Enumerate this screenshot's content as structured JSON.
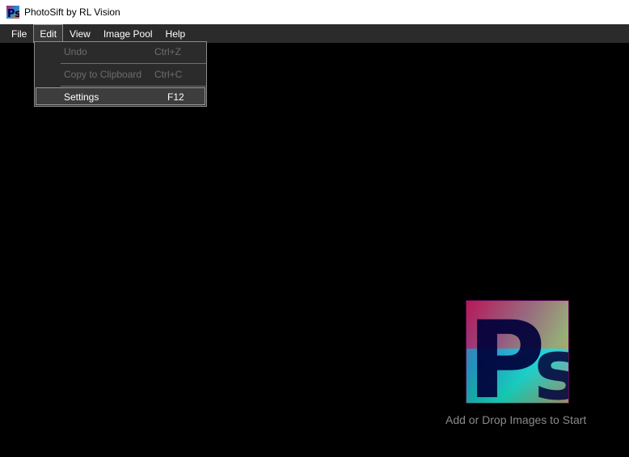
{
  "window": {
    "title": "PhotoSift by RL Vision"
  },
  "menubar": {
    "items": [
      {
        "label": "File"
      },
      {
        "label": "Edit"
      },
      {
        "label": "View"
      },
      {
        "label": "Image Pool"
      },
      {
        "label": "Help"
      }
    ],
    "open_menu": "Edit"
  },
  "edit_menu": {
    "items": [
      {
        "label": "Undo",
        "shortcut": "Ctrl+Z",
        "enabled": false
      },
      {
        "label": "Copy to Clipboard",
        "shortcut": "Ctrl+C",
        "enabled": false
      },
      {
        "label": "Settings",
        "shortcut": "F12",
        "enabled": true,
        "highlighted": true
      }
    ]
  },
  "main": {
    "drop_hint": "Add or Drop Images to Start",
    "logo_icon": "photosift-logo-icon"
  },
  "colors": {
    "titlebar_bg": "#ffffff",
    "menubar_bg": "#2b2b2b",
    "canvas_bg": "#000000",
    "menu_border": "#8c8c8c",
    "disabled_text": "#6d6d6d",
    "hint_text": "#8a8a8a"
  }
}
